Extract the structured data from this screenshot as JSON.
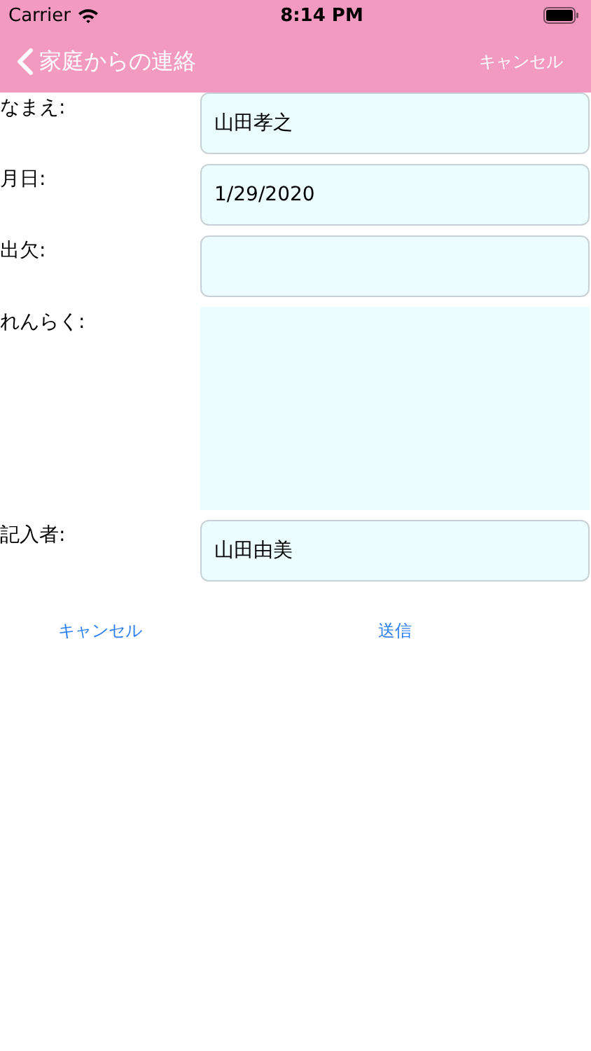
{
  "status_bar": {
    "carrier": "Carrier",
    "time": "8:14 PM"
  },
  "nav_bar": {
    "back_label": "家庭からの連絡",
    "right_button": "キャンセル"
  },
  "fields": [
    {
      "label": "なまえ:",
      "kind": "input",
      "value": "山田孝之"
    },
    {
      "label": "月日:",
      "kind": "input",
      "value": "1/29/2020"
    },
    {
      "label": "出欠:",
      "kind": "input"
    },
    {
      "label": "れんらく:",
      "kind": "textarea"
    },
    {
      "label": "記入者:",
      "kind": "input",
      "value": "山田由美"
    }
  ],
  "buttons": [
    "キャンセル",
    "送信"
  ]
}
